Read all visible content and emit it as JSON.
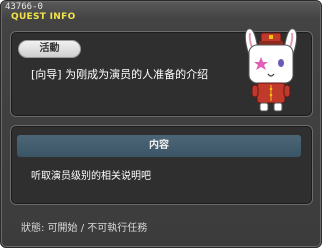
{
  "window": {
    "quest_id": "43766-0",
    "title": "QUEST INFO"
  },
  "activity": {
    "badge": "活動",
    "quest_name": "[向导] 为刚成为演员的人准备的介绍"
  },
  "npc": {
    "icon": "rabbit-bellhop-npc-icon"
  },
  "content": {
    "header": "内容",
    "text": "听取演员级别的相关说明吧"
  },
  "status": {
    "text": "狀態: 可開始 / 不可執行任務"
  },
  "colors": {
    "title": "#f2e24a",
    "header_bar": "#4d6677",
    "panel": "#2f2f2f",
    "window": "#434343"
  }
}
